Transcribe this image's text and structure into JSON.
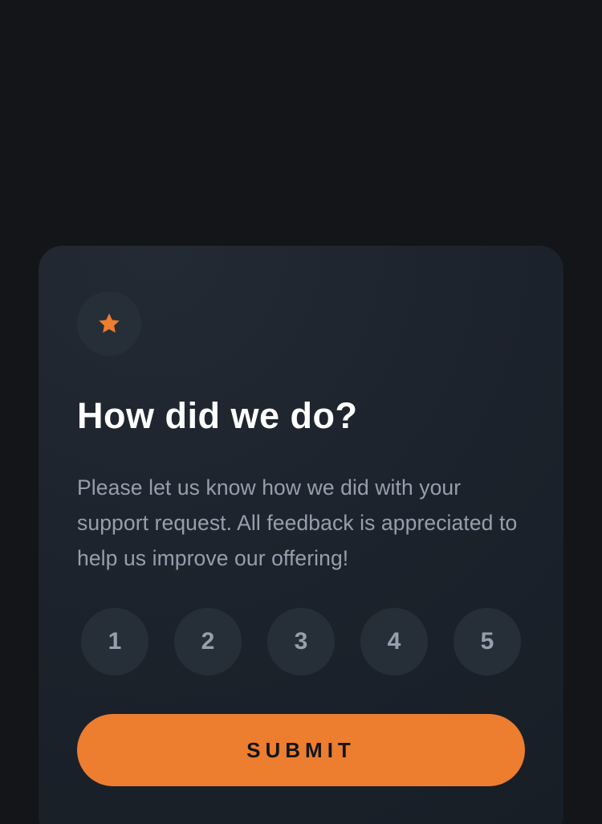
{
  "colors": {
    "background": "#131518",
    "card": "#1c222b",
    "badge": "#262f38",
    "accent": "#ed7d2f",
    "text_primary": "#ffffff",
    "text_muted": "#969fad"
  },
  "card": {
    "icon": "star-icon",
    "title": "How did we do?",
    "description": "Please let us know how we did with your support request. All feedback is appreciated to help us improve our offering!",
    "ratings": [
      "1",
      "2",
      "3",
      "4",
      "5"
    ],
    "submit_label": "SUBMIT"
  }
}
